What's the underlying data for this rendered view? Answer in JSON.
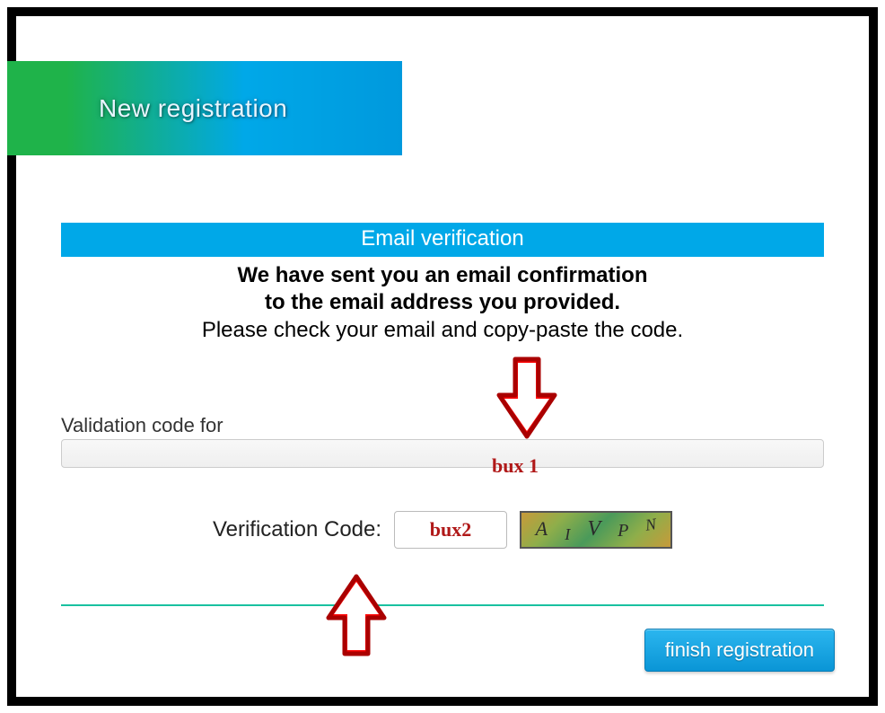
{
  "header": {
    "title": "New registration"
  },
  "section": {
    "title": "Email verification",
    "line1": "We have sent you an email confirmation",
    "line2": "to the email address you provided.",
    "line3": "Please check your email and copy-paste the code."
  },
  "validation": {
    "label": "Validation code for",
    "value": ""
  },
  "verification": {
    "label": "Verification Code:",
    "value": "",
    "captcha": [
      "A",
      "I",
      "V",
      "P",
      "N"
    ]
  },
  "buttons": {
    "finish": "finish registration"
  },
  "annotations": {
    "bux1": "bux 1",
    "bux2": "bux2"
  },
  "colors": {
    "accent_blue": "#00a8e8",
    "accent_green": "#1fb34a",
    "annotation_red": "#b01818",
    "teal": "#19c1a0"
  }
}
